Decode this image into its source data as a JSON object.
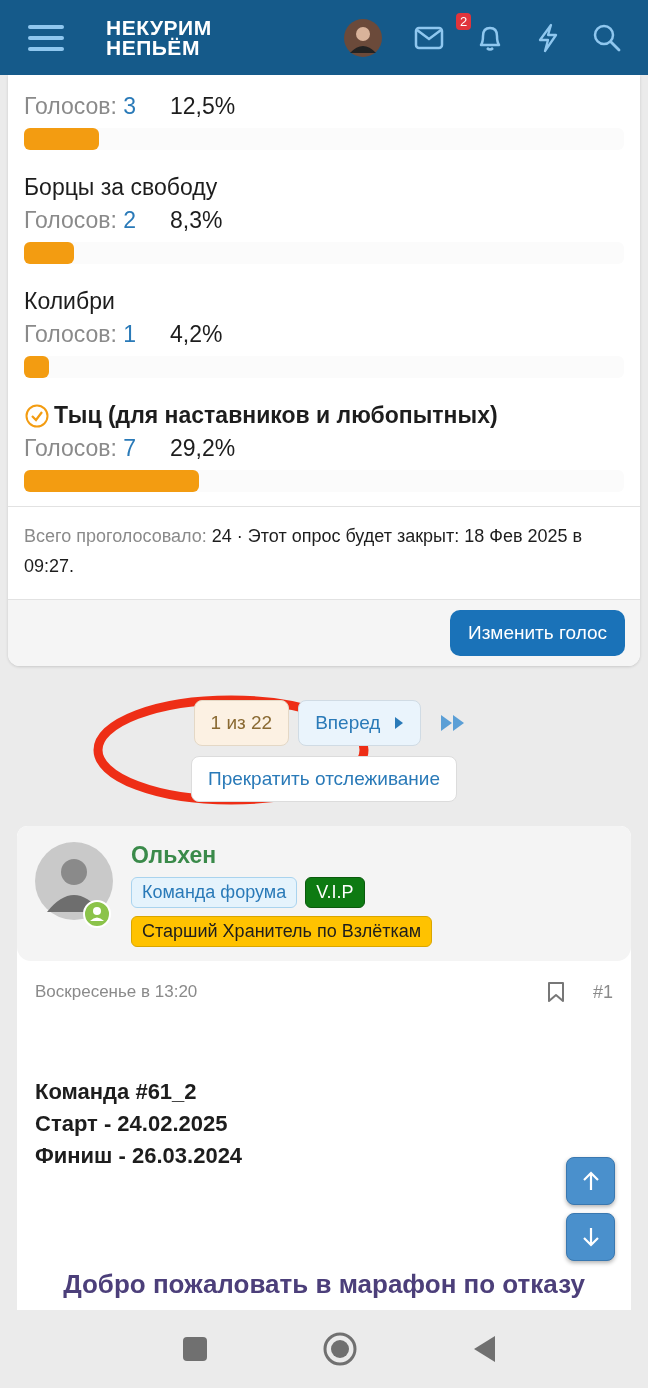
{
  "header": {
    "logo_lines": [
      "НЕКУРИМ",
      "НЕПЬЁМ"
    ],
    "notification_count": "2"
  },
  "poll": {
    "options": [
      {
        "votes_label": "Голосов:",
        "votes": "3",
        "percent": "12,5%",
        "level": 0.125,
        "voted": false
      },
      {
        "name": "Борцы за свободу",
        "votes_label": "Голосов:",
        "votes": "2",
        "percent": "8,3%",
        "level": 0.083,
        "voted": false
      },
      {
        "name": "Колибри",
        "votes_label": "Голосов:",
        "votes": "1",
        "percent": "4,2%",
        "level": 0.042,
        "voted": false
      },
      {
        "name": "Тыц (для наставников и любопытных)",
        "votes_label": "Голосов:",
        "votes": "7",
        "percent": "29,2%",
        "level": 0.292,
        "voted": true
      }
    ],
    "summary_label": "Всего проголосовало:",
    "summary_text": "24 · Этот опрос будет закрыт: 18 Фев 2025 в 09:27.",
    "change_vote_button": "Изменить голос"
  },
  "pagination": {
    "current": "1 из 22",
    "next": "Вперед",
    "unwatch": "Прекратить отслеживание"
  },
  "post": {
    "author": "Ольхен",
    "online": true,
    "badges": [
      {
        "text": "Команда форума",
        "kind": "team"
      },
      {
        "text": "V.I.P",
        "kind": "vip"
      },
      {
        "text": "Старший Хранитель по Взлёткам",
        "kind": "title"
      }
    ],
    "date": "Воскресенье в 13:20",
    "number": "#1",
    "lines": [
      "Команда #61_2",
      "Старт - 24.02.2025",
      "Финиш - 26.03.2024"
    ],
    "heading": "Добро пожаловать в марафон по отказу"
  }
}
